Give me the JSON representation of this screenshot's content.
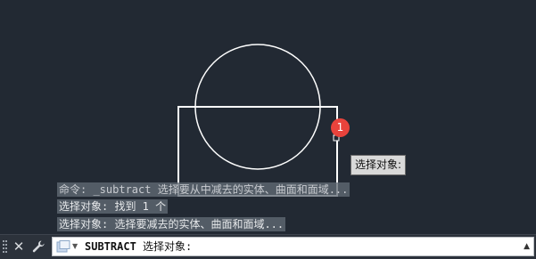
{
  "drawing": {
    "selection_marker": "1"
  },
  "tooltip": {
    "text": "选择对象:"
  },
  "command_history": [
    "命令: _subtract 选择要从中减去的实体、曲面和面域...",
    "选择对象: 找到 1 个",
    "选择对象:  选择要减去的实体、曲面和面域..."
  ],
  "command_line": {
    "command_name": "SUBTRACT",
    "prompt": "选择对象:",
    "icons": [
      "grip-icon",
      "close-icon",
      "wrench-icon",
      "command-prompt-icon",
      "history-dropdown-icon"
    ]
  },
  "colors": {
    "canvas_background": "#222933",
    "geometry": "#ffffff",
    "marker": "#e8433c"
  }
}
